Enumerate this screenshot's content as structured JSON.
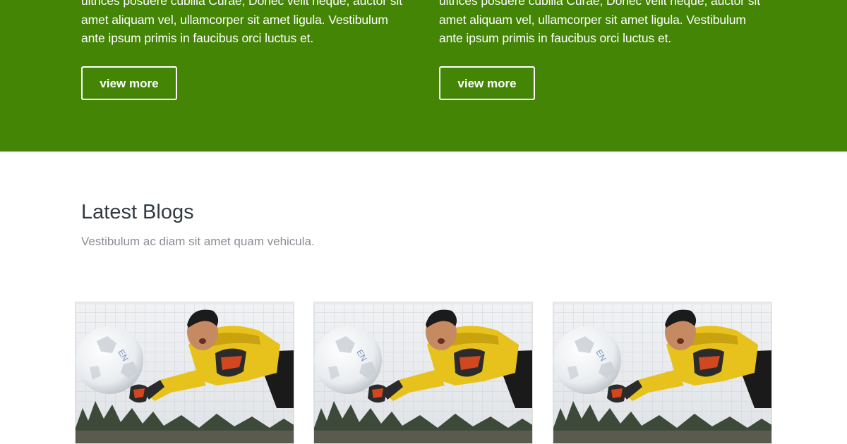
{
  "promos": [
    {
      "text": "ultrices posuere cubilia Curae; Donec velit neque, auctor sit amet aliquam vel, ullamcorper sit amet ligula. Vestibulum ante ipsum primis in faucibus orci luctus et.",
      "button_label": "view more"
    },
    {
      "text": "ultrices posuere cubilia Curae; Donec velit neque, auctor sit amet aliquam vel, ullamcorper sit amet ligula. Vestibulum ante ipsum primis in faucibus orci luctus et.",
      "button_label": "view more"
    }
  ],
  "blogs": {
    "title": "Latest Blogs",
    "subtitle": "Vestibulum ac diam sit amet quam vehicula.",
    "cards": [
      {
        "image": "goalkeeper-diving-photo"
      },
      {
        "image": "goalkeeper-diving-photo"
      },
      {
        "image": "goalkeeper-diving-photo"
      }
    ]
  },
  "colors": {
    "band_green": "#448506",
    "jersey_yellow": "#e8c21c",
    "text_dark": "#333a44",
    "text_muted": "#8a8d93"
  }
}
